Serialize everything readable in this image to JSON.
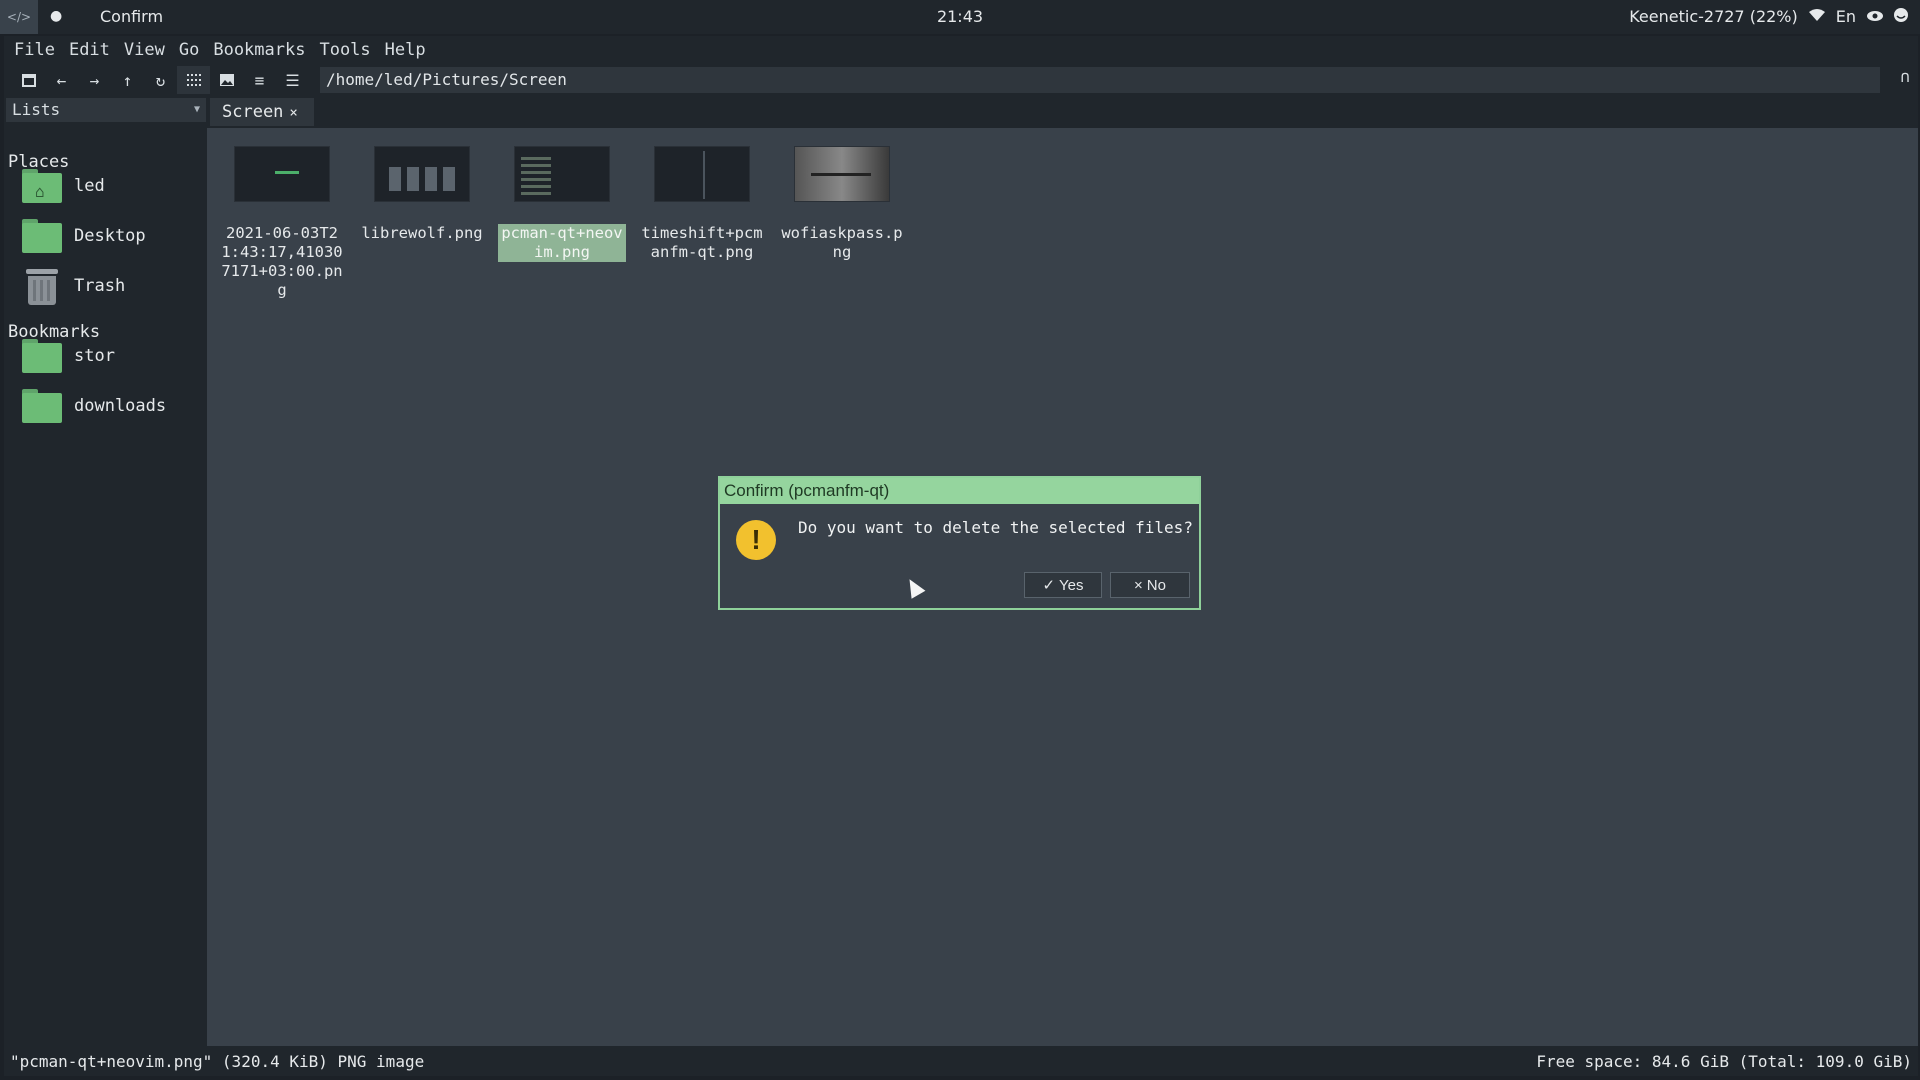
{
  "topbar": {
    "workspace_icon": "code-icon",
    "chat_icon": "speech-bubble-icon",
    "window_title": "Confirm",
    "clock": "21:43",
    "network": "Keenetic-2727 (22%)",
    "wifi_icon": "wifi-icon",
    "layout": "En",
    "eye_icon": "eye-icon",
    "tray_icon": "smile-icon"
  },
  "menubar": {
    "items": [
      "File",
      "Edit",
      "View",
      "Go",
      "Bookmarks",
      "Tools",
      "Help"
    ]
  },
  "toolbar": {
    "buttons": [
      "new-tab-icon",
      "back-icon",
      "forward-icon",
      "up-icon",
      "reload-icon",
      "icon-view-icon",
      "thumbnail-view-icon",
      "compact-view-icon",
      "detailed-list-icon"
    ],
    "path": "/home/led/Pictures/Screen",
    "end_icon": "filter-icon"
  },
  "sidepane": {
    "mode": "Lists",
    "places_heading": "Places",
    "places": [
      "led",
      "Desktop",
      "Trash"
    ],
    "bookmarks_heading": "Bookmarks",
    "bookmarks": [
      "stor",
      "downloads"
    ]
  },
  "tabs": [
    {
      "label": "Screen",
      "close": "×"
    }
  ],
  "files": [
    {
      "name": "2021-06-03T21:43:17,410307171+03:00.png",
      "selected": false
    },
    {
      "name": "librewolf.png",
      "selected": false
    },
    {
      "name": "pcman-qt+neovim.png",
      "selected": true
    },
    {
      "name": "timeshift+pcmanfm-qt.png",
      "selected": false
    },
    {
      "name": "wofiaskpass.png",
      "selected": false
    }
  ],
  "status": {
    "left": "\"pcman-qt+neovim.png\" (320.4 KiB) PNG image",
    "right": "Free space: 84.6 GiB (Total: 109.0 GiB)"
  },
  "dialog": {
    "title": "Confirm (pcmanfm-qt)",
    "icon": "warning-icon",
    "message": "Do you want to delete the selected files?",
    "yes_label": "Yes",
    "no_label": "No"
  },
  "colors": {
    "accent": "#95d59e",
    "folder": "#6cbc76",
    "warning": "#f2c12e",
    "selection": "#8fb496"
  }
}
